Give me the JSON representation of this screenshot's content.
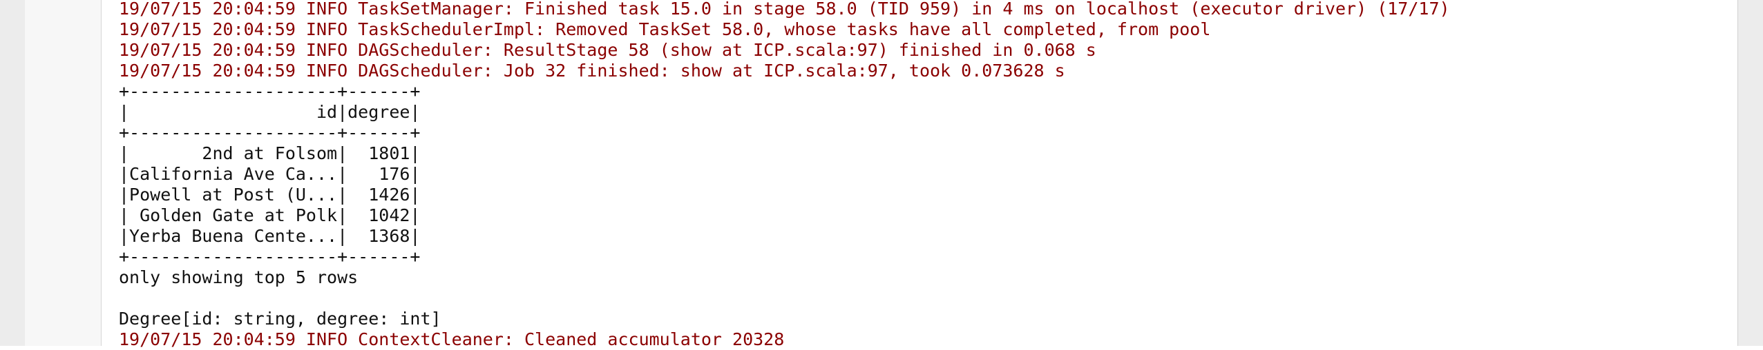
{
  "colors": {
    "stderr_text": "#8b0000",
    "stdout_text": "#111111",
    "gutter": "#ececec"
  },
  "output": {
    "lines": [
      {
        "stream": "stderr",
        "text": "19/07/15 20:04:59 INFO TaskSetManager: Finished task 15.0 in stage 58.0 (TID 959) in 4 ms on localhost (executor driver) (17/17)"
      },
      {
        "stream": "stderr",
        "text": "19/07/15 20:04:59 INFO TaskSchedulerImpl: Removed TaskSet 58.0, whose tasks have all completed, from pool"
      },
      {
        "stream": "stderr",
        "text": "19/07/15 20:04:59 INFO DAGScheduler: ResultStage 58 (show at ICP.scala:97) finished in 0.068 s"
      },
      {
        "stream": "stderr",
        "text": "19/07/15 20:04:59 INFO DAGScheduler: Job 32 finished: show at ICP.scala:97, took 0.073628 s"
      },
      {
        "stream": "stdout",
        "text": "+--------------------+------+"
      },
      {
        "stream": "stdout",
        "text": "|                  id|degree|"
      },
      {
        "stream": "stdout",
        "text": "+--------------------+------+"
      },
      {
        "stream": "stdout",
        "text": "|       2nd at Folsom|  1801|"
      },
      {
        "stream": "stdout",
        "text": "|California Ave Ca...|   176|"
      },
      {
        "stream": "stdout",
        "text": "|Powell at Post (U...|  1426|"
      },
      {
        "stream": "stdout",
        "text": "| Golden Gate at Polk|  1042|"
      },
      {
        "stream": "stdout",
        "text": "|Yerba Buena Cente...|  1368|"
      },
      {
        "stream": "stdout",
        "text": "+--------------------+------+"
      },
      {
        "stream": "stdout",
        "text": "only showing top 5 rows"
      },
      {
        "stream": "stdout",
        "text": ""
      },
      {
        "stream": "stdout",
        "text": "Degree[id: string, degree: int]"
      },
      {
        "stream": "stderr",
        "text": "19/07/15 20:04:59 INFO ContextCleaner: Cleaned accumulator 20328"
      }
    ]
  }
}
